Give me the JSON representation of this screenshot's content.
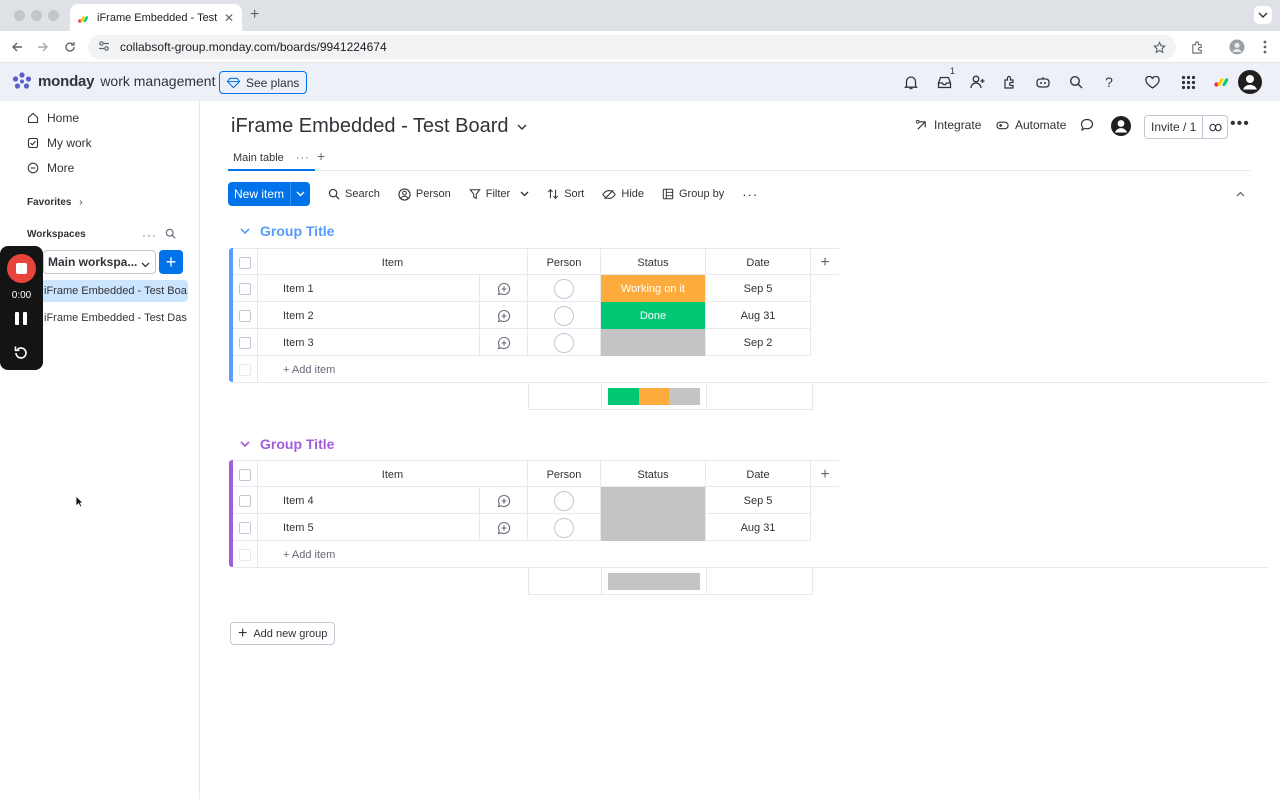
{
  "browser": {
    "tab_title": "iFrame Embedded - Test Board",
    "url": "collabsoft-group.monday.com/boards/9941224674"
  },
  "app": {
    "brand": "monday",
    "product": "work management",
    "see_plans": "See plans",
    "inbox_badge": "1"
  },
  "sidebar": {
    "home": "Home",
    "my_work": "My work",
    "more": "More",
    "favorites": "Favorites",
    "workspaces": "Workspaces",
    "workspace_name": "Main workspa...",
    "items": [
      "iFrame Embedded - Test Boa...",
      "iFrame Embedded - Test Das..."
    ]
  },
  "recorder": {
    "time": "0:00"
  },
  "board": {
    "title": "iFrame Embedded - Test Board",
    "integrate": "Integrate",
    "automate": "Automate",
    "invite": "Invite / 1",
    "main_tab": "Main table"
  },
  "actions": {
    "new_item": "New item",
    "search": "Search",
    "person": "Person",
    "filter": "Filter",
    "sort": "Sort",
    "hide": "Hide",
    "group_by": "Group by"
  },
  "columns": {
    "item": "Item",
    "person": "Person",
    "status": "Status",
    "date": "Date"
  },
  "groups": [
    {
      "title": "Group Title",
      "color": "#579bfc",
      "rows": [
        {
          "name": "Item 1",
          "status": "Working on it",
          "status_color": "#fdab3d",
          "date": "Sep 5"
        },
        {
          "name": "Item 2",
          "status": "Done",
          "status_color": "#00c875",
          "date": "Aug 31"
        },
        {
          "name": "Item 3",
          "status": "",
          "status_color": "#c4c4c4",
          "date": "Sep 2"
        }
      ],
      "add_item": "+ Add item",
      "status_summary": [
        {
          "color": "#00c875",
          "share": 0.333
        },
        {
          "color": "#fdab3d",
          "share": 0.333
        },
        {
          "color": "#c4c4c4",
          "share": 0.334
        }
      ]
    },
    {
      "title": "Group Title",
      "color": "#a25ddc",
      "rows": [
        {
          "name": "Item 4",
          "status": "",
          "status_color": "#c4c4c4",
          "date": "Sep 5"
        },
        {
          "name": "Item 5",
          "status": "",
          "status_color": "#c4c4c4",
          "date": "Aug 31"
        }
      ],
      "add_item": "+ Add item",
      "status_summary": [
        {
          "color": "#c4c4c4",
          "share": 1.0
        }
      ]
    }
  ],
  "add_new_group": "Add new group"
}
